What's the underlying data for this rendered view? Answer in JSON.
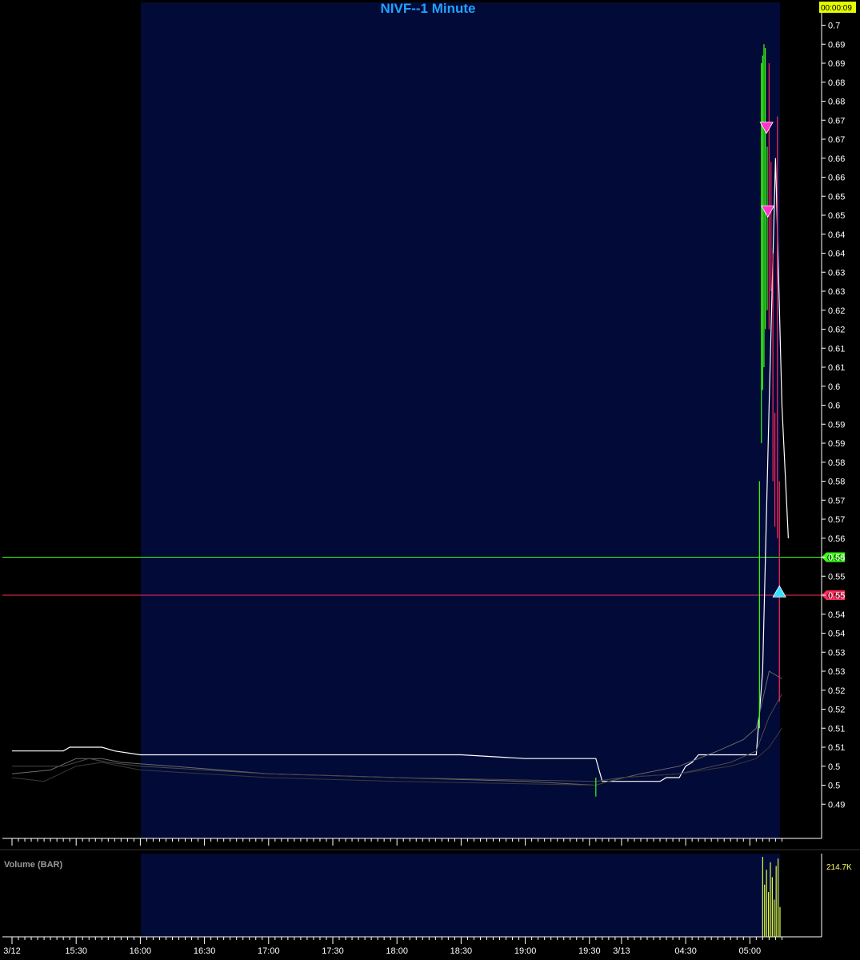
{
  "chart_data": {
    "type": "line",
    "title": "NIVF--1 Minute",
    "timer": "00:00:09",
    "y_axis": {
      "ylim": [
        0.486,
        0.706
      ],
      "tick_labels": [
        "0.7",
        "0.69",
        "0.69",
        "0.68",
        "0.68",
        "0.67",
        "0.67",
        "0.66",
        "0.66",
        "0.65",
        "0.65",
        "0.64",
        "0.64",
        "0.63",
        "0.63",
        "0.62",
        "0.62",
        "0.61",
        "0.61",
        "0.6",
        "0.6",
        "0.59",
        "0.59",
        "0.58",
        "0.58",
        "0.57",
        "0.57",
        "0.56",
        "0.56",
        "0.55",
        "0.55",
        "0.54",
        "0.54",
        "0.53",
        "0.53",
        "0.52",
        "0.52",
        "0.51",
        "0.51",
        "0.5",
        "0.5",
        "0.49"
      ],
      "tick_values": [
        0.7,
        0.695,
        0.69,
        0.685,
        0.68,
        0.675,
        0.67,
        0.665,
        0.66,
        0.655,
        0.65,
        0.645,
        0.64,
        0.635,
        0.63,
        0.625,
        0.62,
        0.615,
        0.61,
        0.605,
        0.6,
        0.595,
        0.59,
        0.585,
        0.58,
        0.575,
        0.57,
        0.565,
        0.56,
        0.555,
        0.55,
        0.545,
        0.54,
        0.535,
        0.53,
        0.525,
        0.52,
        0.515,
        0.51,
        0.505,
        0.5,
        0.495
      ]
    },
    "x_axis": {
      "tick_labels": [
        "3/12",
        "15:30",
        "16:00",
        "16:30",
        "17:00",
        "17:30",
        "18:00",
        "18:30",
        "19:00",
        "19:30",
        "3/13",
        "04:30",
        "05:00"
      ],
      "tick_index": [
        0,
        10,
        20,
        30,
        40,
        50,
        60,
        70,
        80,
        90,
        95,
        105,
        115
      ]
    },
    "levels": [
      {
        "name": "green-level",
        "value": 0.56,
        "label": "0.56",
        "color": "#39ff14"
      },
      {
        "name": "red-level",
        "value": 0.55,
        "label": "0.55",
        "color": "#ff2a5a"
      }
    ],
    "series": [
      {
        "color": "#ffffff",
        "points": [
          [
            0,
            0.509
          ],
          [
            8,
            0.509
          ],
          [
            9,
            0.51
          ],
          [
            14,
            0.51
          ],
          [
            16,
            0.509
          ],
          [
            20,
            0.508
          ],
          [
            40,
            0.508
          ],
          [
            60,
            0.508
          ],
          [
            70,
            0.508
          ],
          [
            80,
            0.507
          ],
          [
            91,
            0.507
          ],
          [
            92,
            0.501
          ],
          [
            101,
            0.501
          ],
          [
            102,
            0.502
          ],
          [
            104,
            0.502
          ],
          [
            105,
            0.505
          ],
          [
            106,
            0.506
          ],
          [
            107,
            0.508
          ],
          [
            115,
            0.508
          ],
          [
            116,
            0.508
          ],
          [
            117,
            0.53
          ],
          [
            118,
            0.6
          ],
          [
            119,
            0.665
          ],
          [
            120,
            0.6
          ],
          [
            121,
            0.565
          ]
        ]
      },
      {
        "color": "#6b6b6b",
        "points": [
          [
            0,
            0.503
          ],
          [
            6,
            0.504
          ],
          [
            10,
            0.507
          ],
          [
            14,
            0.507
          ],
          [
            17,
            0.506
          ],
          [
            25,
            0.505
          ],
          [
            40,
            0.503
          ],
          [
            60,
            0.502
          ],
          [
            80,
            0.501
          ],
          [
            91,
            0.5
          ],
          [
            93,
            0.501
          ],
          [
            98,
            0.503
          ],
          [
            104,
            0.505
          ],
          [
            110,
            0.509
          ],
          [
            114,
            0.512
          ],
          [
            116,
            0.515
          ],
          [
            118,
            0.53
          ],
          [
            120,
            0.528
          ]
        ]
      },
      {
        "color": "#4a4a4a",
        "points": [
          [
            0,
            0.505
          ],
          [
            8,
            0.505
          ],
          [
            12,
            0.507
          ],
          [
            15,
            0.506
          ],
          [
            20,
            0.505
          ],
          [
            40,
            0.503
          ],
          [
            60,
            0.502
          ],
          [
            91,
            0.501
          ],
          [
            95,
            0.502
          ],
          [
            104,
            0.503
          ],
          [
            112,
            0.506
          ],
          [
            116,
            0.509
          ],
          [
            118,
            0.518
          ],
          [
            120,
            0.524
          ]
        ]
      },
      {
        "color": "#3a3a3a",
        "points": [
          [
            0,
            0.502
          ],
          [
            5,
            0.501
          ],
          [
            10,
            0.505
          ],
          [
            14,
            0.506
          ],
          [
            20,
            0.504
          ],
          [
            40,
            0.502
          ],
          [
            60,
            0.501
          ],
          [
            91,
            0.5
          ],
          [
            95,
            0.502
          ],
          [
            104,
            0.503
          ],
          [
            112,
            0.505
          ],
          [
            116,
            0.507
          ],
          [
            118,
            0.51
          ],
          [
            120,
            0.515
          ]
        ]
      }
    ],
    "bars": [
      {
        "i": 91,
        "h": 0.502,
        "l": 0.497,
        "c": "#39ff14"
      },
      {
        "i": 116.5,
        "h": 0.58,
        "l": 0.515,
        "c": "#39ff14"
      },
      {
        "i": 116.8,
        "h": 0.69,
        "l": 0.59,
        "c": "#39ff14"
      },
      {
        "i": 117.0,
        "h": 0.692,
        "l": 0.604,
        "c": "#39ff14"
      },
      {
        "i": 117.2,
        "h": 0.695,
        "l": 0.61,
        "c": "#39ff14"
      },
      {
        "i": 117.4,
        "h": 0.694,
        "l": 0.62,
        "c": "#39ff14"
      },
      {
        "i": 117.7,
        "h": 0.668,
        "l": 0.625,
        "c": "#39ff14"
      },
      {
        "i": 118.0,
        "h": 0.69,
        "l": 0.62,
        "c": "#ff2a5a"
      },
      {
        "i": 118.3,
        "h": 0.664,
        "l": 0.63,
        "c": "#ff2a5a"
      },
      {
        "i": 118.6,
        "h": 0.64,
        "l": 0.58,
        "c": "#ff2a5a"
      },
      {
        "i": 118.9,
        "h": 0.598,
        "l": 0.568,
        "c": "#ff2a5a"
      },
      {
        "i": 119.3,
        "h": 0.676,
        "l": 0.565,
        "c": "#ff2a5a"
      },
      {
        "i": 119.6,
        "h": 0.58,
        "l": 0.522,
        "c": "#ff2a5a"
      }
    ],
    "markers": [
      {
        "type": "sell",
        "i": 117.6,
        "value": 0.673,
        "color": "#ff33cc"
      },
      {
        "type": "sell",
        "i": 117.8,
        "value": 0.651,
        "color": "#ff33cc"
      },
      {
        "type": "buy",
        "i": 119.6,
        "value": 0.551,
        "color": "#33e0ff"
      }
    ],
    "volume": {
      "label": "Volume (BAR)",
      "max_label": "214.7K",
      "max": 214700,
      "bars": [
        {
          "i": 117.0,
          "v": 214700
        },
        {
          "i": 117.3,
          "v": 140000
        },
        {
          "i": 117.6,
          "v": 180000
        },
        {
          "i": 117.9,
          "v": 120000
        },
        {
          "i": 118.2,
          "v": 200000
        },
        {
          "i": 118.5,
          "v": 160000
        },
        {
          "i": 118.8,
          "v": 100000
        },
        {
          "i": 119.1,
          "v": 190000
        },
        {
          "i": 119.4,
          "v": 210000
        },
        {
          "i": 119.7,
          "v": 80000
        }
      ]
    }
  }
}
